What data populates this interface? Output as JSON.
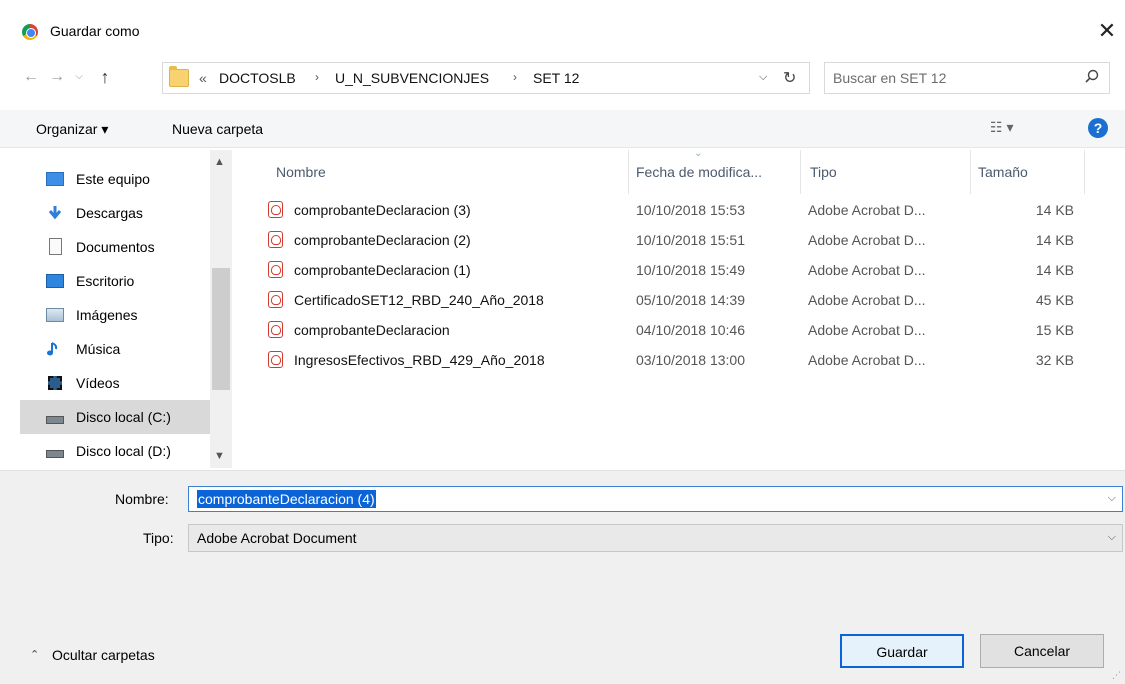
{
  "window": {
    "title": "Guardar como",
    "close_glyph": "✕"
  },
  "nav": {
    "back": "←",
    "forward": "→",
    "recent": "⌵",
    "up": "↑"
  },
  "address": {
    "overflow": "«",
    "crumbs": [
      "DOCTOSLB",
      "U_N_SUBVENCIONJES",
      "SET 12"
    ],
    "separator": "›",
    "dropdown": "⌵",
    "refresh": "↻"
  },
  "search": {
    "placeholder": "Buscar en SET 12"
  },
  "toolbar": {
    "organize_label": "Organizar ▾",
    "new_folder_label": "Nueva carpeta",
    "view_glyph": "☷ ▾",
    "help_glyph": "?"
  },
  "sidebar": {
    "items": [
      {
        "label": "Este equipo",
        "icon": "computer-icon"
      },
      {
        "label": "Descargas",
        "icon": "download-icon"
      },
      {
        "label": "Documentos",
        "icon": "documents-icon"
      },
      {
        "label": "Escritorio",
        "icon": "desktop-icon"
      },
      {
        "label": "Imágenes",
        "icon": "pictures-icon"
      },
      {
        "label": "Música",
        "icon": "music-icon"
      },
      {
        "label": "Vídeos",
        "icon": "videos-icon"
      },
      {
        "label": "Disco local (C:)",
        "icon": "drive-icon",
        "selected": true
      },
      {
        "label": "Disco local (D:)",
        "icon": "drive-icon"
      }
    ]
  },
  "file_list": {
    "columns": [
      "Nombre",
      "Fecha de modifica...",
      "Tipo",
      "Tamaño"
    ],
    "rows": [
      {
        "name": "comprobanteDeclaracion (3)",
        "date": "10/10/2018 15:53",
        "type": "Adobe Acrobat D...",
        "size": "14 KB"
      },
      {
        "name": "comprobanteDeclaracion (2)",
        "date": "10/10/2018 15:51",
        "type": "Adobe Acrobat D...",
        "size": "14 KB"
      },
      {
        "name": "comprobanteDeclaracion (1)",
        "date": "10/10/2018 15:49",
        "type": "Adobe Acrobat D...",
        "size": "14 KB"
      },
      {
        "name": "CertificadoSET12_RBD_240_Año_2018",
        "date": "05/10/2018 14:39",
        "type": "Adobe Acrobat D...",
        "size": "45 KB"
      },
      {
        "name": "comprobanteDeclaracion",
        "date": "04/10/2018 10:46",
        "type": "Adobe Acrobat D...",
        "size": "15 KB"
      },
      {
        "name": "IngresosEfectivos_RBD_429_Año_2018",
        "date": "03/10/2018 13:00",
        "type": "Adobe Acrobat D...",
        "size": "32 KB"
      }
    ]
  },
  "form": {
    "name_label": "Nombre:",
    "name_value": "comprobanteDeclaracion (4)",
    "type_label": "Tipo:",
    "type_value": "Adobe Acrobat Document"
  },
  "footer": {
    "hide_folders_label": "Ocultar carpetas",
    "save_label": "Guardar",
    "cancel_label": "Cancelar"
  },
  "colors": {
    "accent": "#0a64d8",
    "pdf_red": "#d23b2e",
    "help_blue": "#1a6fd0"
  }
}
